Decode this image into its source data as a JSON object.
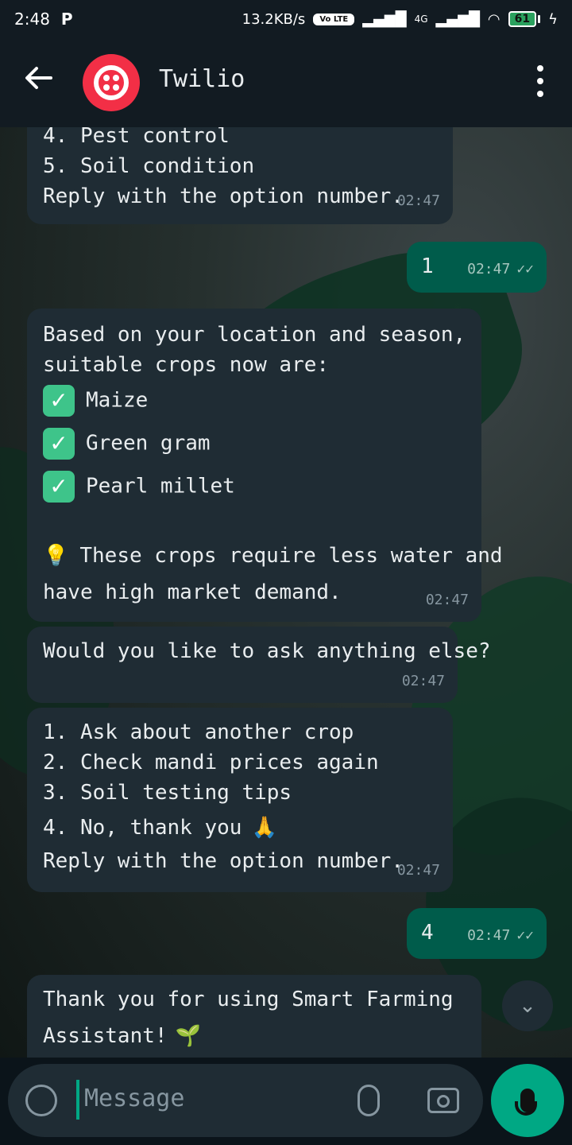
{
  "status_bar": {
    "time": "2:48",
    "p_icon": "P",
    "network_speed": "13.2KB/s",
    "volte_badge": "Vo LTE",
    "network_type": "4G",
    "battery": "61"
  },
  "header": {
    "title": "Twilio",
    "back_icon": "arrow-left-icon",
    "menu_icon": "more-vert-icon",
    "avatar_color": "#f22f46"
  },
  "messages": [
    {
      "lines": [
        "4. Pest control",
        "5. Soil condition",
        "Reply with the option number."
      ],
      "time": "02:47",
      "dir": "in"
    },
    {
      "text": "1",
      "time": "02:47",
      "dir": "out",
      "status": "read"
    },
    {
      "lines": [
        "Based on your location and season,",
        "suitable crops now are:"
      ],
      "items": [
        "Maize",
        "Green gram",
        "Pearl millet"
      ],
      "tip": [
        "These crops require less water and",
        "have high market demand."
      ],
      "time": "02:47",
      "dir": "in"
    },
    {
      "text": "Would you like to ask anything else?",
      "time": "02:47",
      "dir": "in"
    },
    {
      "lines": [
        "1. Ask about another crop",
        "2. Check mandi prices again",
        "3. Soil testing tips",
        "4. No, thank you",
        "Reply with the option number."
      ],
      "time": "02:47",
      "dir": "in"
    },
    {
      "text": "4",
      "time": "02:47",
      "dir": "out",
      "status": "read"
    },
    {
      "lines": [
        "Thank you for using Smart Farming",
        "Assistant!"
      ],
      "dir": "in"
    }
  ],
  "input": {
    "placeholder": "Message"
  },
  "colors": {
    "incoming_bubble": "#1f2c34",
    "outgoing_bubble": "#005c4b",
    "accent": "#00a884"
  }
}
